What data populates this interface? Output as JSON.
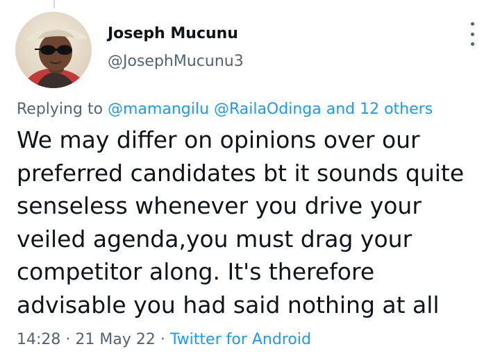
{
  "author": {
    "name": "Joseph Mucunu",
    "handle": "@JosephMucunu3",
    "avatar_icon": "profile-photo"
  },
  "reply": {
    "prefix": "Replying to",
    "mentions": [
      "@mamangilu",
      "@RailaOdinga"
    ],
    "and": "and",
    "others": "12 others"
  },
  "tweet": {
    "lines": [
      "We may differ on opinions over our",
      "preferred candidates bt it sounds quite",
      "senseless whenever you drive your",
      "veiled agenda,you must drag your",
      "competitor along. It's therefore",
      "advisable you had said nothing at all"
    ]
  },
  "meta": {
    "time": "14:28",
    "separator": "·",
    "date": "21 May 22",
    "source": "Twitter for Android"
  },
  "colors": {
    "text": "#0f1419",
    "secondary": "#536471",
    "link": "#1d9bf0"
  },
  "icons": {
    "more": "more-options-icon"
  }
}
